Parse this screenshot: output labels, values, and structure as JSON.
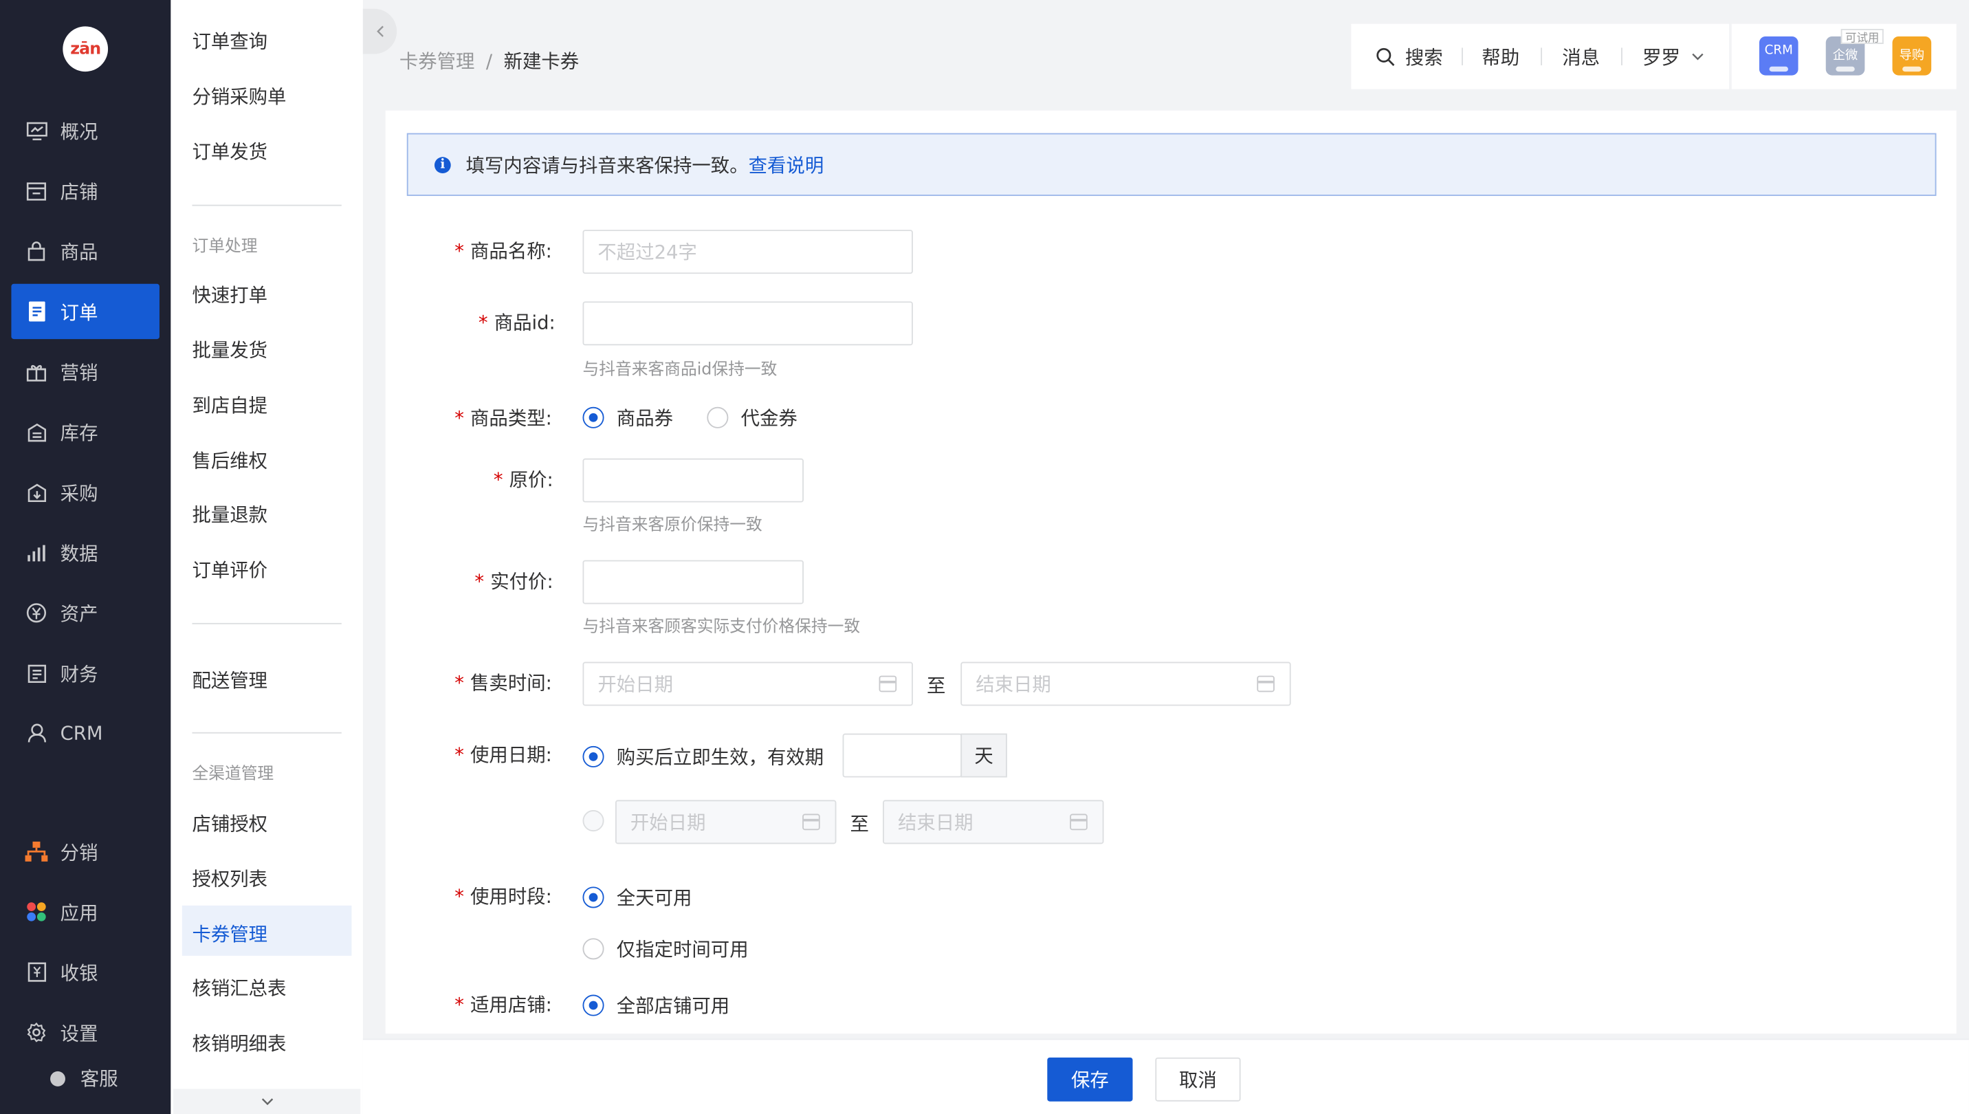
{
  "logo_text": "zān",
  "nav": [
    {
      "label": "概况",
      "icon": "overview-icon"
    },
    {
      "label": "店铺",
      "icon": "store-icon"
    },
    {
      "label": "商品",
      "icon": "bag-icon"
    },
    {
      "label": "订单",
      "icon": "order-icon",
      "active": true
    },
    {
      "label": "营销",
      "icon": "gift-icon"
    },
    {
      "label": "库存",
      "icon": "inventory-icon"
    },
    {
      "label": "采购",
      "icon": "purchase-icon"
    },
    {
      "label": "数据",
      "icon": "chart-icon"
    },
    {
      "label": "资产",
      "icon": "yen-icon"
    },
    {
      "label": "财务",
      "icon": "finance-icon"
    },
    {
      "label": "CRM",
      "icon": "user-icon"
    },
    {
      "label": "分销",
      "icon": "distribution-icon"
    },
    {
      "label": "应用",
      "icon": "apps-icon"
    },
    {
      "label": "收银",
      "icon": "cashier-icon"
    },
    {
      "label": "设置",
      "icon": "gear-icon"
    }
  ],
  "kefu": "客服",
  "subnav": {
    "group1": [
      "订单查询",
      "分销采购单",
      "订单发货"
    ],
    "title2": "订单处理",
    "group2": [
      "快速打单",
      "批量发货",
      "到店自提",
      "售后维权",
      "批量退款",
      "订单评价"
    ],
    "group3": [
      "配送管理"
    ],
    "title4": "全渠道管理",
    "group4": [
      "店铺授权",
      "授权列表",
      "卡券管理",
      "核销汇总表",
      "核销明细表"
    ]
  },
  "breadcrumb": {
    "parent": "卡券管理",
    "sep": "/",
    "current": "新建卡券"
  },
  "topbar": {
    "search": "搜索",
    "help": "帮助",
    "message": "消息",
    "user": "罗罗"
  },
  "apps": {
    "crm": "CRM",
    "wecom": "企微",
    "trial": "可试用",
    "guide": "导购"
  },
  "notice": {
    "text": "填写内容请与抖音来客保持一致。",
    "link": "查看说明"
  },
  "form": {
    "req": "*",
    "name_label": "商品名称:",
    "name_placeholder": "不超过24字",
    "id_label": "商品id:",
    "id_hint": "与抖音来客商品id保持一致",
    "type_label": "商品类型:",
    "type_opt1": "商品券",
    "type_opt2": "代金券",
    "price_label": "原价:",
    "price_hint": "与抖音来客原价保持一致",
    "paid_label": "实付价:",
    "paid_hint": "与抖音来客顾客实际支付价格保持一致",
    "sale_label": "售卖时间:",
    "start_ph": "开始日期",
    "end_ph": "结束日期",
    "to": "至",
    "use_date_label": "使用日期:",
    "use_opt1": "购买后立即生效，有效期",
    "day": "天",
    "period_label": "使用时段:",
    "period_opt1": "全天可用",
    "period_opt2": "仅指定时间可用",
    "store_label": "适用店铺:",
    "store_opt1": "全部店铺可用"
  },
  "footer": {
    "save": "保存",
    "cancel": "取消"
  },
  "colors": {
    "primary": "#155bd4",
    "sidebar": "#1f2231",
    "required": "#d40000"
  }
}
